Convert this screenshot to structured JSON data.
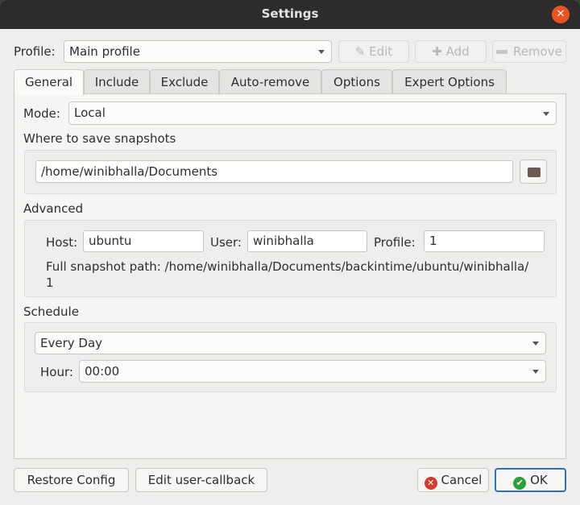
{
  "window": {
    "title": "Settings"
  },
  "profile": {
    "label": "Profile:",
    "value": "Main profile",
    "edit_label": "Edit",
    "add_label": "Add",
    "remove_label": "Remove"
  },
  "tabs": [
    {
      "label": "General",
      "active": true
    },
    {
      "label": "Include"
    },
    {
      "label": "Exclude"
    },
    {
      "label": "Auto-remove"
    },
    {
      "label": "Options"
    },
    {
      "label": "Expert Options"
    }
  ],
  "general": {
    "mode_label": "Mode:",
    "mode_value": "Local",
    "where_label": "Where to save snapshots",
    "path_value": "/home/winibhalla/Documents",
    "advanced_label": "Advanced",
    "host_label": "Host:",
    "host_value": "ubuntu",
    "user_label": "User:",
    "user_value": "winibhalla",
    "profile_label": "Profile:",
    "profile_value": "1",
    "full_path_line1": "Full snapshot path: /home/winibhalla/Documents/backintime/ubuntu/winibhalla/",
    "full_path_line2": "1",
    "schedule_label": "Schedule",
    "schedule_value": "Every Day",
    "hour_label": "Hour:",
    "hour_value": "00:00"
  },
  "footer": {
    "restore_label": "Restore Config",
    "callback_label": "Edit user-callback",
    "cancel_label": "Cancel",
    "ok_label": "OK"
  },
  "colors": {
    "accent": "#e95420",
    "ok_green": "#2e9e3a",
    "cancel_red": "#d33a2c"
  }
}
